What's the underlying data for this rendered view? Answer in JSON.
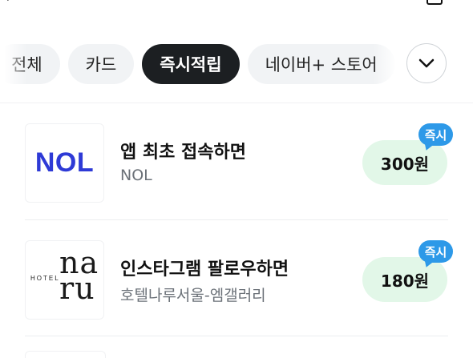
{
  "filters": {
    "chips": [
      {
        "label": "전체",
        "active": false
      },
      {
        "label": "카드",
        "active": false
      },
      {
        "label": "즉시적립",
        "active": true
      },
      {
        "label": "네이버+ 스토어",
        "active": false
      }
    ],
    "expand_icon": "chevron-down-icon"
  },
  "offers": [
    {
      "logo_text": "NOL",
      "logo_color": "#2E3AD6",
      "title": "앱 최초 접속하면",
      "advertiser": "NOL",
      "reward": "300원",
      "badge": "즉시"
    },
    {
      "logo_text": "HOTEL naru",
      "title": "인스타그램 팔로우하면",
      "advertiser": "호텔나루서울-엠갤러리",
      "reward": "180원",
      "badge": "즉시"
    }
  ],
  "colors": {
    "active_chip": "#1C1F22",
    "chip_bg": "#F1F3F5",
    "reward_bg": "#E2F7E8",
    "badge_bg": "#2D99E8"
  }
}
